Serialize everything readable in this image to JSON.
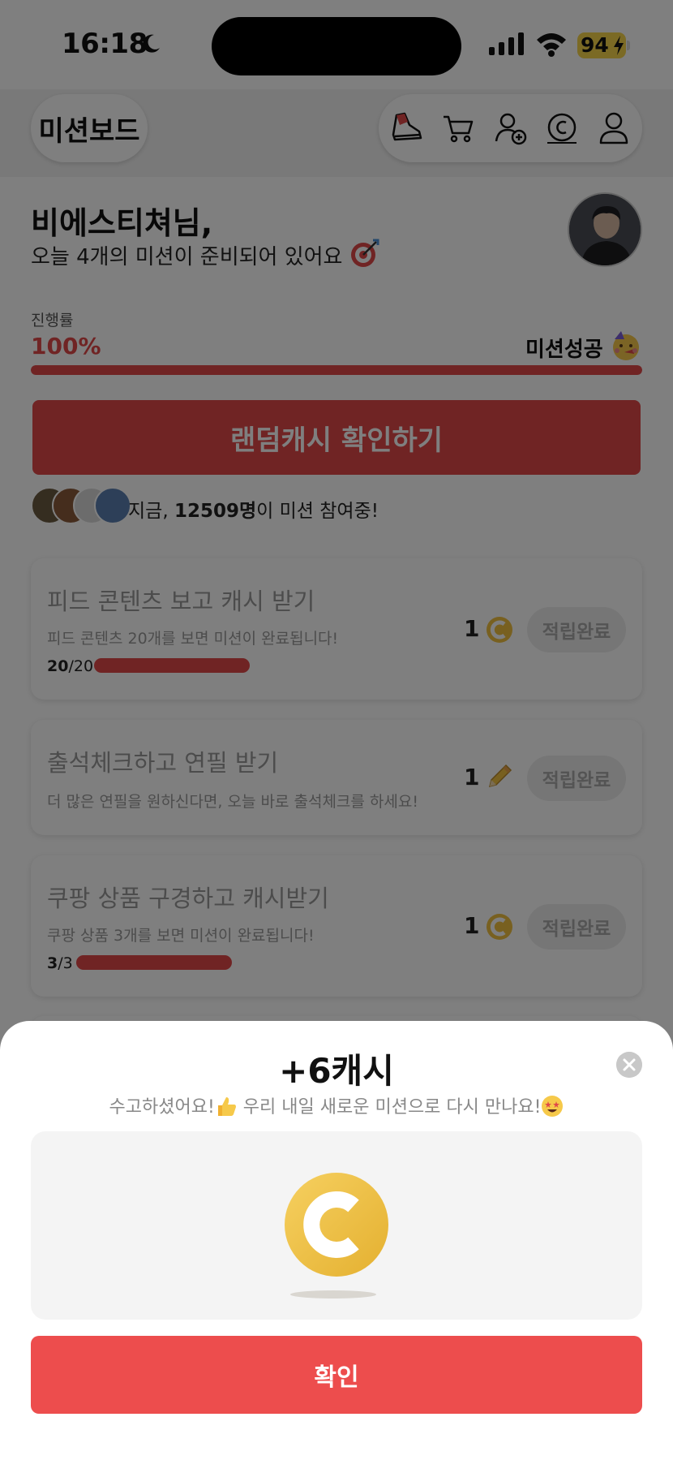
{
  "status_bar": {
    "time": "16:18",
    "battery": "94"
  },
  "header": {
    "brand": "미션보드",
    "nav_icons": [
      "sneaker-icon",
      "cart-icon",
      "add-friend-icon",
      "coin-icon",
      "profile-icon"
    ]
  },
  "profile": {
    "greeting": "비에스티쳐님,",
    "subtitle": "오늘 4개의 미션이 준비되어 있어요",
    "progress_label": "진행률",
    "progress_value": "100%",
    "progress_fraction": 1.0,
    "success_label": "미션성공"
  },
  "random_cash_button": "랜덤캐시 확인하기",
  "participants": {
    "prefix": "지금, ",
    "count": "12509명",
    "suffix": "이 미션 참여중!"
  },
  "missions": [
    {
      "title": "피드 콘텐츠 보고 캐시 받기",
      "desc": "피드 콘텐츠 20개를 보면 미션이 완료됩니다!",
      "done": "20",
      "total": "/20",
      "progress": 1.0,
      "reward": "1",
      "reward_icon": "coin-icon",
      "button": "적립완료"
    },
    {
      "title": "출석체크하고 연필 받기",
      "desc": "더 많은 연필을 원하신다면, 오늘 바로 출석체크를 하세요!",
      "reward": "1",
      "reward_icon": "pencil-icon",
      "button": "적립완료"
    },
    {
      "title": "쿠팡 상품 구경하고 캐시받기",
      "desc": "쿠팡 상품 3개를 보면 미션이 완료됩니다!",
      "done": "3",
      "total": "/3",
      "progress": 1.0,
      "reward": "1",
      "reward_icon": "coin-icon",
      "button": "적립완료"
    }
  ],
  "sheet": {
    "title": "+6캐시",
    "subtitle_a": "수고하셨어요!",
    "subtitle_b": " 우리 내일 새로운 미션으로 다시 만나요!",
    "confirm": "확인"
  },
  "colors": {
    "accent": "#e04848",
    "confirm": "#ed4d4d",
    "coin": "#f0c040"
  }
}
